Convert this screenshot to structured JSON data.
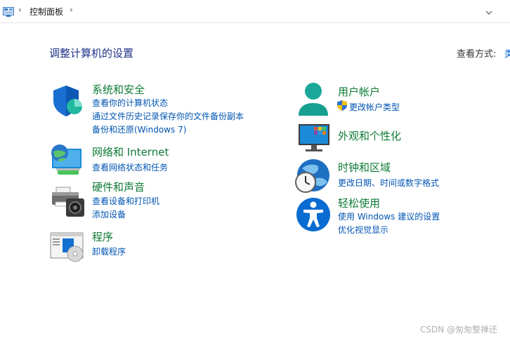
{
  "address": {
    "breadcrumb": "控制面板",
    "icon": "control-panel-icon"
  },
  "header": {
    "title": "调整计算机的设置",
    "view_by_label": "查看方式:",
    "view_by_value": "类"
  },
  "categories_left": [
    {
      "title": "系统和安全",
      "icon": "shield-icon",
      "links": [
        "查看你的计算机状态",
        "通过文件历史记录保存你的文件备份副本",
        "备份和还原(Windows 7)"
      ]
    },
    {
      "title": "网络和 Internet",
      "icon": "network-globe-icon",
      "links": [
        "查看网络状态和任务"
      ]
    },
    {
      "title": "硬件和声音",
      "icon": "printer-speaker-icon",
      "links": [
        "查看设备和打印机",
        "添加设备"
      ]
    },
    {
      "title": "程序",
      "icon": "programs-icon",
      "links": [
        "卸载程序"
      ]
    }
  ],
  "categories_right": [
    {
      "title": "用户帐户",
      "icon": "user-icon",
      "links": [
        "更改帐户类型"
      ]
    },
    {
      "title": "外观和个性化",
      "icon": "monitor-icon",
      "links": []
    },
    {
      "title": "时钟和区域",
      "icon": "clock-globe-icon",
      "links": [
        "更改日期、时间或数字格式"
      ]
    },
    {
      "title": "轻松使用",
      "icon": "accessibility-icon",
      "links": [
        "使用 Windows 建议的设置",
        "优化视觉显示"
      ]
    }
  ],
  "watermark": "CSDN @匆匆整禅还"
}
